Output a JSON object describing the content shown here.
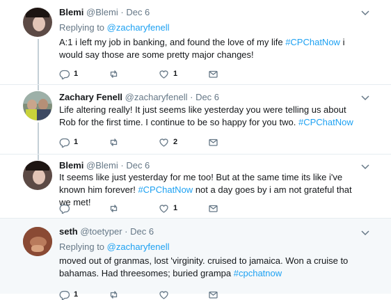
{
  "colors": {
    "link": "#1da1f2",
    "secondary": "#657786",
    "divider": "#e6ecf0",
    "highlight_bg": "#f5f8fa"
  },
  "tweets": [
    {
      "name": "Blemi",
      "handle": "@Blemi",
      "date": "Dec 6",
      "reply_prefix": "Replying to",
      "reply_to": "@zacharyfenell",
      "body": [
        {
          "t": "A:1 i left my job in banking, and found the love of my life "
        },
        {
          "t": "#CPChatNow",
          "link": true
        },
        {
          "t": " i would say those are some pretty major changes!"
        }
      ],
      "counts": {
        "replies": "1",
        "retweets": "",
        "likes": "1"
      }
    },
    {
      "name": "Zachary Fenell",
      "handle": "@zacharyfenell",
      "date": "Dec 6",
      "body": [
        {
          "t": "Life altering really! It just seems like yesterday you were telling us about Rob for the first time. I continue to be so happy for you two. "
        },
        {
          "t": "#CPChatNow",
          "link": true
        }
      ],
      "counts": {
        "replies": "1",
        "retweets": "",
        "likes": "2"
      }
    },
    {
      "name": "Blemi",
      "handle": "@Blemi",
      "date": "Dec 6",
      "body": [
        {
          "t": "It seems like just yesterday for me too! But at the same time its like i've known him forever! "
        },
        {
          "t": "#CPChatNow",
          "link": true
        },
        {
          "t": " not a day goes by i am not grateful that we met!"
        }
      ],
      "counts": {
        "replies": "",
        "retweets": "",
        "likes": "1"
      }
    },
    {
      "name": "seth",
      "handle": "@toetyper",
      "date": "Dec 6",
      "reply_prefix": "Replying to",
      "reply_to": "@zacharyfenell",
      "body": [
        {
          "t": "moved out of granmas, lost  'virginity.  cruised to jamaica.  Won a cruise to bahamas.  Had threesomes; buried grampa "
        },
        {
          "t": "#cpchatnow",
          "link": true
        }
      ],
      "counts": {
        "replies": "1",
        "retweets": "",
        "likes": ""
      }
    }
  ]
}
